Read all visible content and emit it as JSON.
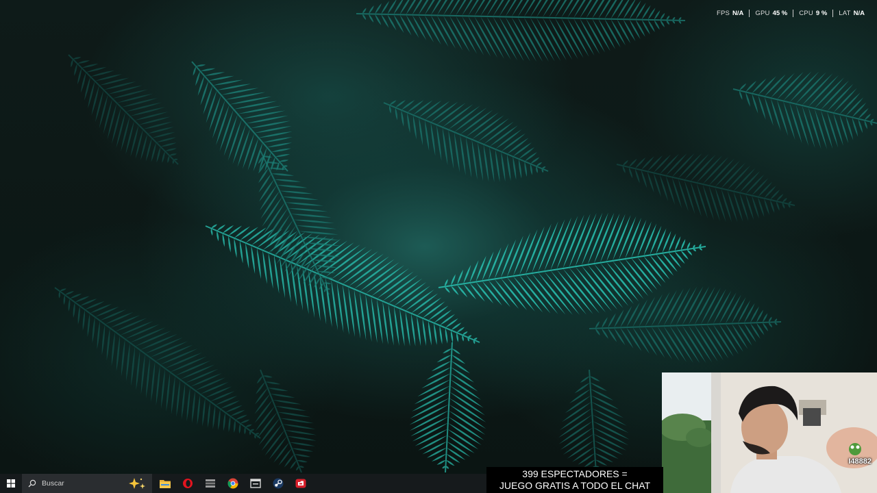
{
  "overlay": {
    "fps_label": "FPS",
    "fps_value": "N/A",
    "gpu_label": "GPU",
    "gpu_value": "45 %",
    "cpu_label": "CPU",
    "cpu_value": "9 %",
    "lat_label": "LAT",
    "lat_value": "N/A"
  },
  "caption": {
    "line1": "399 ESPECTADORES =",
    "line2": "JUEGO GRATIS A TODO EL CHAT"
  },
  "webcam": {
    "badge": "I48882"
  },
  "taskbar": {
    "start_icon": "windows-start-icon",
    "search_placeholder": "Buscar",
    "pinned": [
      "file-explorer-icon",
      "opera-gx-icon",
      "launcher-icon",
      "chrome-icon",
      "desktop-app-icon",
      "steam-icon",
      "red-game-app-icon"
    ]
  },
  "colors": {
    "fern_bright": "#27b5a6",
    "fern_mid": "#1c7f76",
    "fern_dark": "#14524c",
    "taskbar_bg": "#161a1c",
    "search_bg": "#2a2d30"
  }
}
